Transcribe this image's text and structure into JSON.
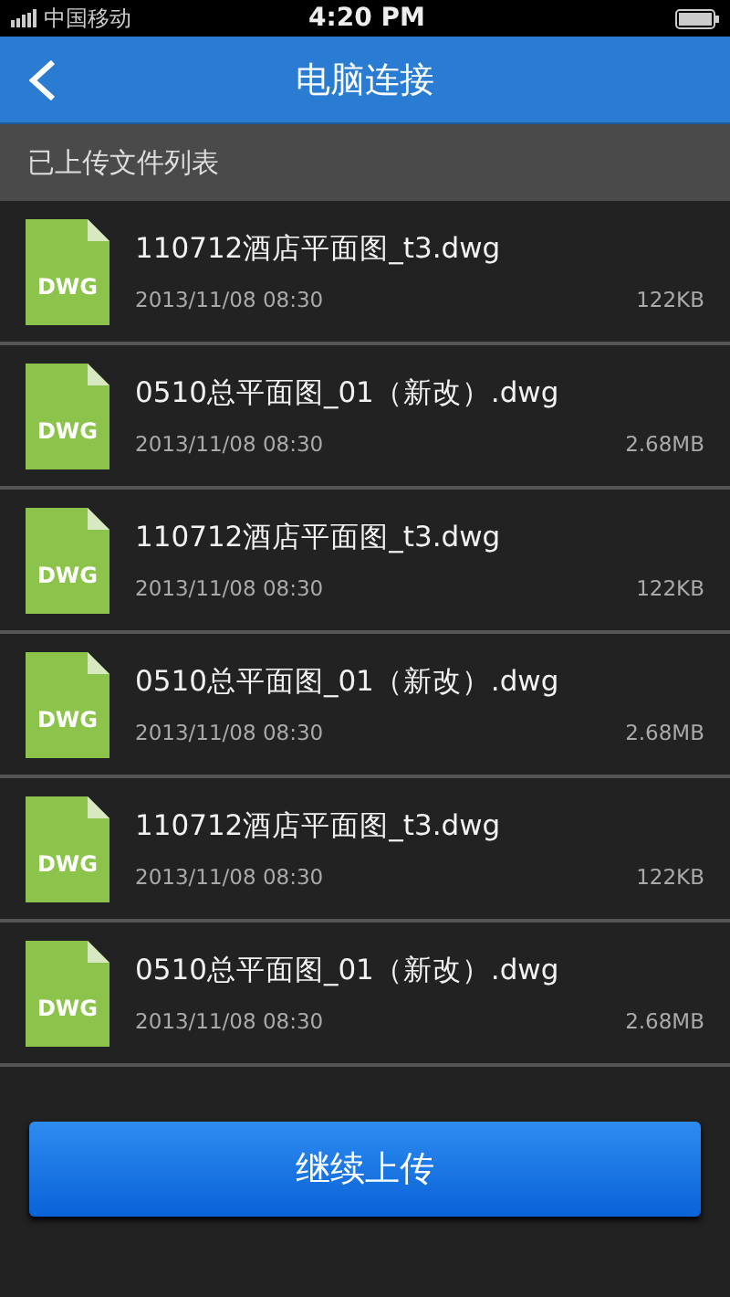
{
  "status_bar": {
    "carrier": "中国移动",
    "time": "4:20 PM"
  },
  "nav": {
    "title": "电脑连接"
  },
  "section": {
    "title": "已上传文件列表"
  },
  "files": [
    {
      "type": "DWG",
      "name": "110712酒店平面图_t3.dwg",
      "date": "2013/11/08  08:30",
      "size": "122KB"
    },
    {
      "type": "DWG",
      "name": "0510总平面图_01（新改）.dwg",
      "date": "2013/11/08  08:30",
      "size": "2.68MB"
    },
    {
      "type": "DWG",
      "name": "110712酒店平面图_t3.dwg",
      "date": "2013/11/08  08:30",
      "size": "122KB"
    },
    {
      "type": "DWG",
      "name": "0510总平面图_01（新改）.dwg",
      "date": "2013/11/08  08:30",
      "size": "2.68MB"
    },
    {
      "type": "DWG",
      "name": "110712酒店平面图_t3.dwg",
      "date": "2013/11/08  08:30",
      "size": "122KB"
    },
    {
      "type": "DWG",
      "name": "0510总平面图_01（新改）.dwg",
      "date": "2013/11/08  08:30",
      "size": "2.68MB"
    }
  ],
  "button": {
    "label": "继续上传"
  }
}
